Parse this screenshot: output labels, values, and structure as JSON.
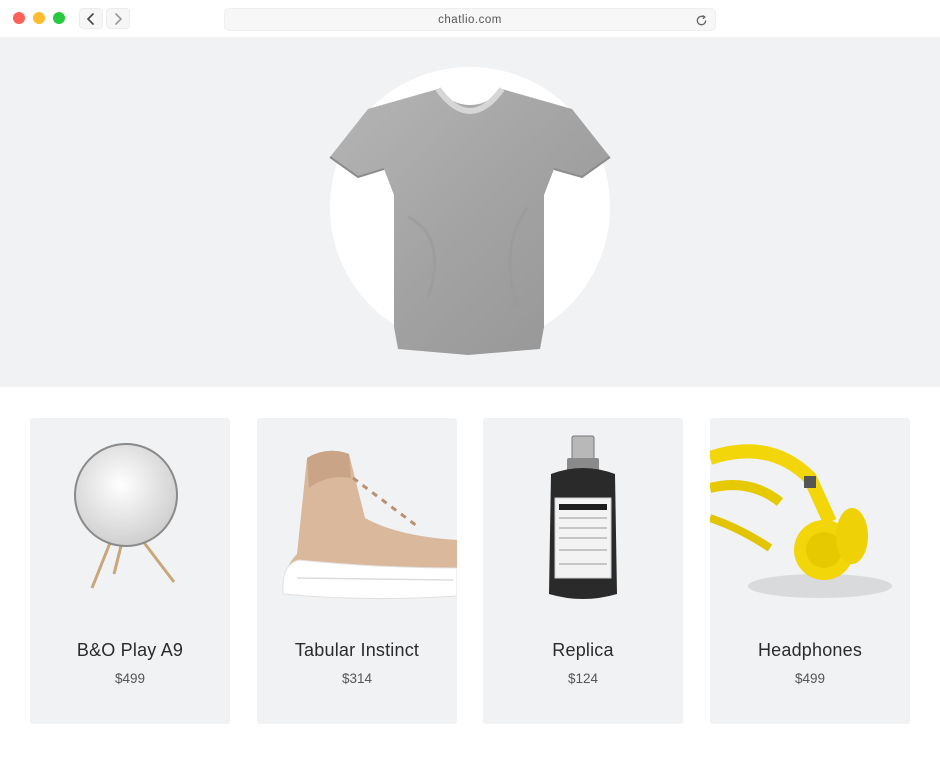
{
  "browser": {
    "url": "chatlio.com",
    "icons": [
      "chevron-left-icon",
      "chevron-right-icon",
      "reload-icon"
    ]
  },
  "hero": {
    "image": "t-shirt"
  },
  "products": [
    {
      "name": "B&O Play A9",
      "price": "$499",
      "image": "speaker"
    },
    {
      "name": "Tabular Instinct",
      "price": "$314",
      "image": "sneaker"
    },
    {
      "name": "Replica",
      "price": "$124",
      "image": "perfume-bottle"
    },
    {
      "name": "Headphones",
      "price": "$499",
      "image": "headphones"
    }
  ],
  "colors": {
    "close": "#fe5f57",
    "minimize": "#febc2e",
    "maximize": "#28c840",
    "panel": "#f1f2f4",
    "headphones": "#f2d60a"
  }
}
